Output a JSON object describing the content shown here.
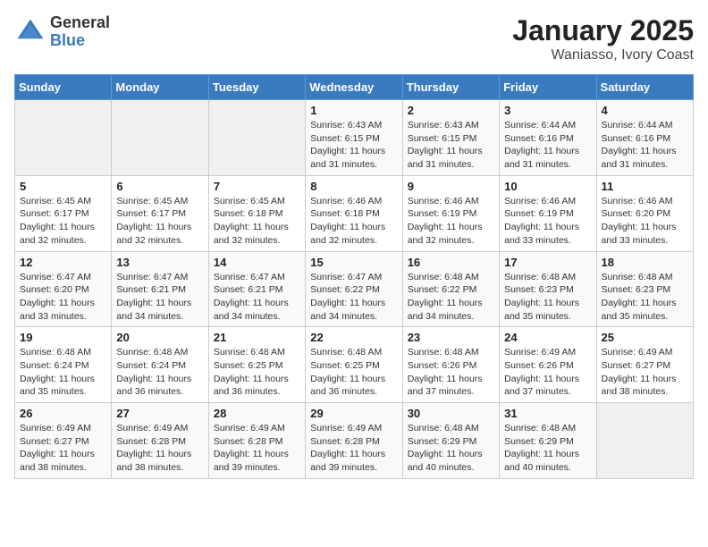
{
  "header": {
    "logo_general": "General",
    "logo_blue": "Blue",
    "title": "January 2025",
    "subtitle": "Waniasso, Ivory Coast"
  },
  "weekdays": [
    "Sunday",
    "Monday",
    "Tuesday",
    "Wednesday",
    "Thursday",
    "Friday",
    "Saturday"
  ],
  "weeks": [
    [
      {
        "day": "",
        "info": ""
      },
      {
        "day": "",
        "info": ""
      },
      {
        "day": "",
        "info": ""
      },
      {
        "day": "1",
        "info": "Sunrise: 6:43 AM\nSunset: 6:15 PM\nDaylight: 11 hours and 31 minutes."
      },
      {
        "day": "2",
        "info": "Sunrise: 6:43 AM\nSunset: 6:15 PM\nDaylight: 11 hours and 31 minutes."
      },
      {
        "day": "3",
        "info": "Sunrise: 6:44 AM\nSunset: 6:16 PM\nDaylight: 11 hours and 31 minutes."
      },
      {
        "day": "4",
        "info": "Sunrise: 6:44 AM\nSunset: 6:16 PM\nDaylight: 11 hours and 31 minutes."
      }
    ],
    [
      {
        "day": "5",
        "info": "Sunrise: 6:45 AM\nSunset: 6:17 PM\nDaylight: 11 hours and 32 minutes."
      },
      {
        "day": "6",
        "info": "Sunrise: 6:45 AM\nSunset: 6:17 PM\nDaylight: 11 hours and 32 minutes."
      },
      {
        "day": "7",
        "info": "Sunrise: 6:45 AM\nSunset: 6:18 PM\nDaylight: 11 hours and 32 minutes."
      },
      {
        "day": "8",
        "info": "Sunrise: 6:46 AM\nSunset: 6:18 PM\nDaylight: 11 hours and 32 minutes."
      },
      {
        "day": "9",
        "info": "Sunrise: 6:46 AM\nSunset: 6:19 PM\nDaylight: 11 hours and 32 minutes."
      },
      {
        "day": "10",
        "info": "Sunrise: 6:46 AM\nSunset: 6:19 PM\nDaylight: 11 hours and 33 minutes."
      },
      {
        "day": "11",
        "info": "Sunrise: 6:46 AM\nSunset: 6:20 PM\nDaylight: 11 hours and 33 minutes."
      }
    ],
    [
      {
        "day": "12",
        "info": "Sunrise: 6:47 AM\nSunset: 6:20 PM\nDaylight: 11 hours and 33 minutes."
      },
      {
        "day": "13",
        "info": "Sunrise: 6:47 AM\nSunset: 6:21 PM\nDaylight: 11 hours and 34 minutes."
      },
      {
        "day": "14",
        "info": "Sunrise: 6:47 AM\nSunset: 6:21 PM\nDaylight: 11 hours and 34 minutes."
      },
      {
        "day": "15",
        "info": "Sunrise: 6:47 AM\nSunset: 6:22 PM\nDaylight: 11 hours and 34 minutes."
      },
      {
        "day": "16",
        "info": "Sunrise: 6:48 AM\nSunset: 6:22 PM\nDaylight: 11 hours and 34 minutes."
      },
      {
        "day": "17",
        "info": "Sunrise: 6:48 AM\nSunset: 6:23 PM\nDaylight: 11 hours and 35 minutes."
      },
      {
        "day": "18",
        "info": "Sunrise: 6:48 AM\nSunset: 6:23 PM\nDaylight: 11 hours and 35 minutes."
      }
    ],
    [
      {
        "day": "19",
        "info": "Sunrise: 6:48 AM\nSunset: 6:24 PM\nDaylight: 11 hours and 35 minutes."
      },
      {
        "day": "20",
        "info": "Sunrise: 6:48 AM\nSunset: 6:24 PM\nDaylight: 11 hours and 36 minutes."
      },
      {
        "day": "21",
        "info": "Sunrise: 6:48 AM\nSunset: 6:25 PM\nDaylight: 11 hours and 36 minutes."
      },
      {
        "day": "22",
        "info": "Sunrise: 6:48 AM\nSunset: 6:25 PM\nDaylight: 11 hours and 36 minutes."
      },
      {
        "day": "23",
        "info": "Sunrise: 6:48 AM\nSunset: 6:26 PM\nDaylight: 11 hours and 37 minutes."
      },
      {
        "day": "24",
        "info": "Sunrise: 6:49 AM\nSunset: 6:26 PM\nDaylight: 11 hours and 37 minutes."
      },
      {
        "day": "25",
        "info": "Sunrise: 6:49 AM\nSunset: 6:27 PM\nDaylight: 11 hours and 38 minutes."
      }
    ],
    [
      {
        "day": "26",
        "info": "Sunrise: 6:49 AM\nSunset: 6:27 PM\nDaylight: 11 hours and 38 minutes."
      },
      {
        "day": "27",
        "info": "Sunrise: 6:49 AM\nSunset: 6:28 PM\nDaylight: 11 hours and 38 minutes."
      },
      {
        "day": "28",
        "info": "Sunrise: 6:49 AM\nSunset: 6:28 PM\nDaylight: 11 hours and 39 minutes."
      },
      {
        "day": "29",
        "info": "Sunrise: 6:49 AM\nSunset: 6:28 PM\nDaylight: 11 hours and 39 minutes."
      },
      {
        "day": "30",
        "info": "Sunrise: 6:48 AM\nSunset: 6:29 PM\nDaylight: 11 hours and 40 minutes."
      },
      {
        "day": "31",
        "info": "Sunrise: 6:48 AM\nSunset: 6:29 PM\nDaylight: 11 hours and 40 minutes."
      },
      {
        "day": "",
        "info": ""
      }
    ]
  ]
}
